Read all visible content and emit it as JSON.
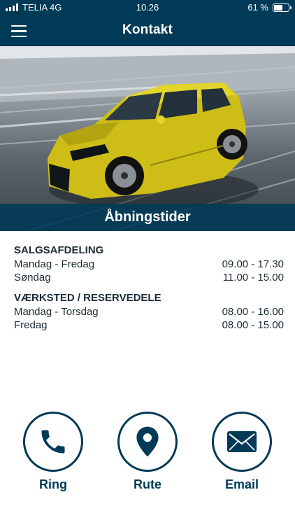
{
  "status_bar": {
    "carrier": "TELIA 4G",
    "time": "10.26",
    "battery_text": "61 %",
    "battery_level": 0.61
  },
  "nav": {
    "title": "Kontakt",
    "menu_icon": "hamburger-menu-icon"
  },
  "hero": {
    "banner_title": "Åbningstider"
  },
  "hours": {
    "sections": [
      {
        "title": "SALGSAFDELING",
        "rows": [
          {
            "days": "Mandag - Fredag",
            "time": "09.00 - 17.30"
          },
          {
            "days": "Søndag",
            "time": "11.00 - 15.00"
          }
        ]
      },
      {
        "title": "VÆRKSTED / RESERVEDELE",
        "rows": [
          {
            "days": "Mandag - Torsdag",
            "time": "08.00 - 16.00"
          },
          {
            "days": "Fredag",
            "time": "08.00 - 15.00"
          }
        ]
      }
    ]
  },
  "actions": {
    "ring": {
      "label": "Ring",
      "icon": "phone-icon"
    },
    "rute": {
      "label": "Rute",
      "icon": "map-pin-icon"
    },
    "email": {
      "label": "Email",
      "icon": "envelope-icon"
    }
  },
  "colors": {
    "brand": "#003a57",
    "car": "#d4c41c"
  }
}
